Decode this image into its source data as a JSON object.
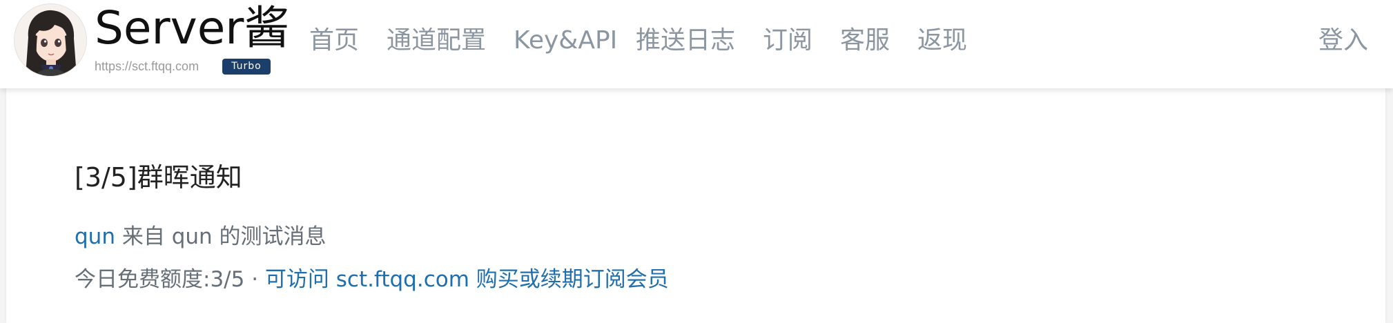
{
  "header": {
    "brand_title": "Server酱",
    "brand_url": "https://sct.ftqq.com",
    "badge": "Turbo",
    "nav": [
      "首页",
      "通道配置",
      "Key&API",
      "推送日志",
      "订阅",
      "客服",
      "返现"
    ],
    "login": "登入"
  },
  "message": {
    "title": "[3/5]群晖通知",
    "sender_link": "qun",
    "body_text": "来自 qun 的测试消息",
    "quota_text": "今日免费额度:3/5 · ",
    "quota_link": "可访问 sct.ftqq.com 购买或续期订阅会员"
  },
  "colors": {
    "nav": "#8b96a1",
    "link": "#1f6fae",
    "badge_bg": "#1b3e6a"
  },
  "icons": {
    "avatar": "anime-girl-avatar"
  }
}
